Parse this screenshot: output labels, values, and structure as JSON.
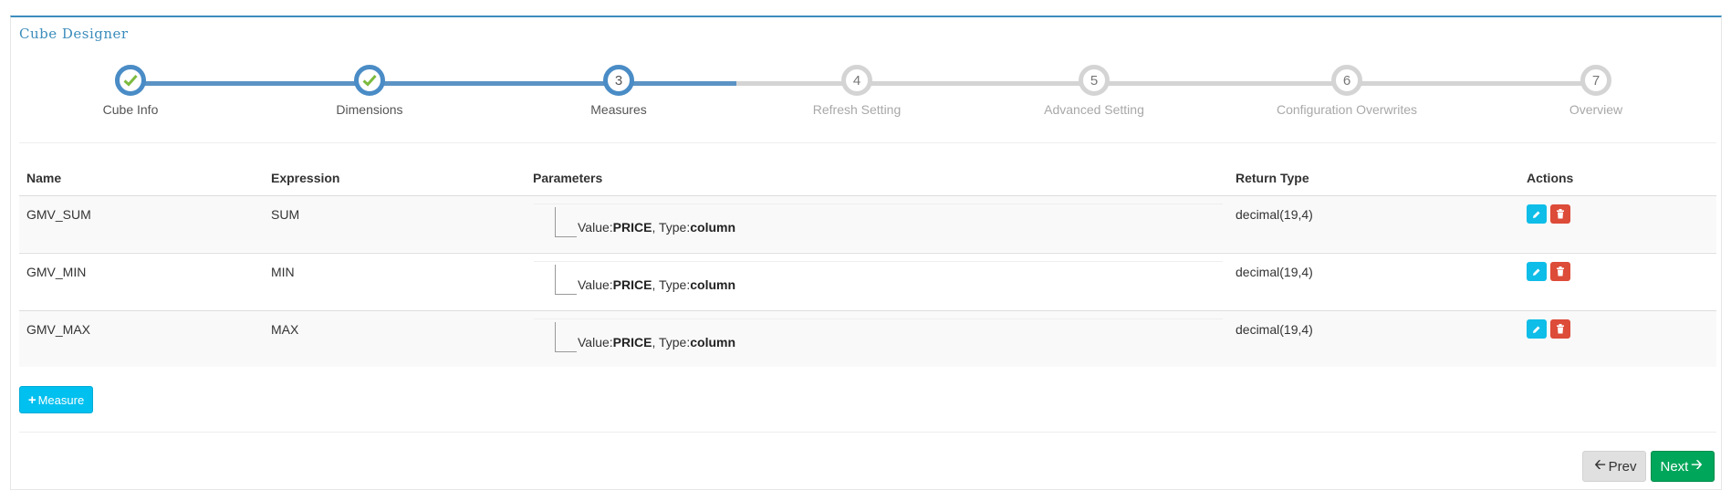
{
  "app": {
    "title": "Cube Designer"
  },
  "colors": {
    "primary": "#3c8dbc",
    "success": "#00a65a",
    "info": "#00c0ef",
    "danger": "#dd4b39",
    "step_done": "#7cbb3f",
    "step_todo": "#d4d4d4"
  },
  "wizard": {
    "steps": [
      {
        "label": "Cube Info",
        "state": "done",
        "icon": "check-icon"
      },
      {
        "label": "Dimensions",
        "state": "done",
        "icon": "check-icon"
      },
      {
        "label": "Measures",
        "state": "active",
        "number": "3"
      },
      {
        "label": "Refresh Setting",
        "state": "todo",
        "number": "4"
      },
      {
        "label": "Advanced Setting",
        "state": "todo",
        "number": "5"
      },
      {
        "label": "Configuration Overwrites",
        "state": "todo",
        "number": "6"
      },
      {
        "label": "Overview",
        "state": "todo",
        "number": "7"
      }
    ]
  },
  "table": {
    "headers": {
      "name": "Name",
      "expression": "Expression",
      "parameters": "Parameters",
      "return_type": "Return Type",
      "actions": "Actions"
    },
    "rows": [
      {
        "name": "GMV_SUM",
        "expression": "SUM",
        "value_label": "Value:",
        "value": "PRICE",
        "type_label": ", Type:",
        "type": "column",
        "return_type": "decimal(19,4)"
      },
      {
        "name": "GMV_MIN",
        "expression": "MIN",
        "value_label": "Value:",
        "value": "PRICE",
        "type_label": ", Type:",
        "type": "column",
        "return_type": "decimal(19,4)"
      },
      {
        "name": "GMV_MAX",
        "expression": "MAX",
        "value_label": "Value:",
        "value": "PRICE",
        "type_label": ", Type:",
        "type": "column",
        "return_type": "decimal(19,4)"
      }
    ],
    "action_icons": [
      "pencil-icon",
      "trash-icon"
    ]
  },
  "buttons": {
    "add_measure": "Measure",
    "prev": "Prev",
    "next": "Next"
  }
}
